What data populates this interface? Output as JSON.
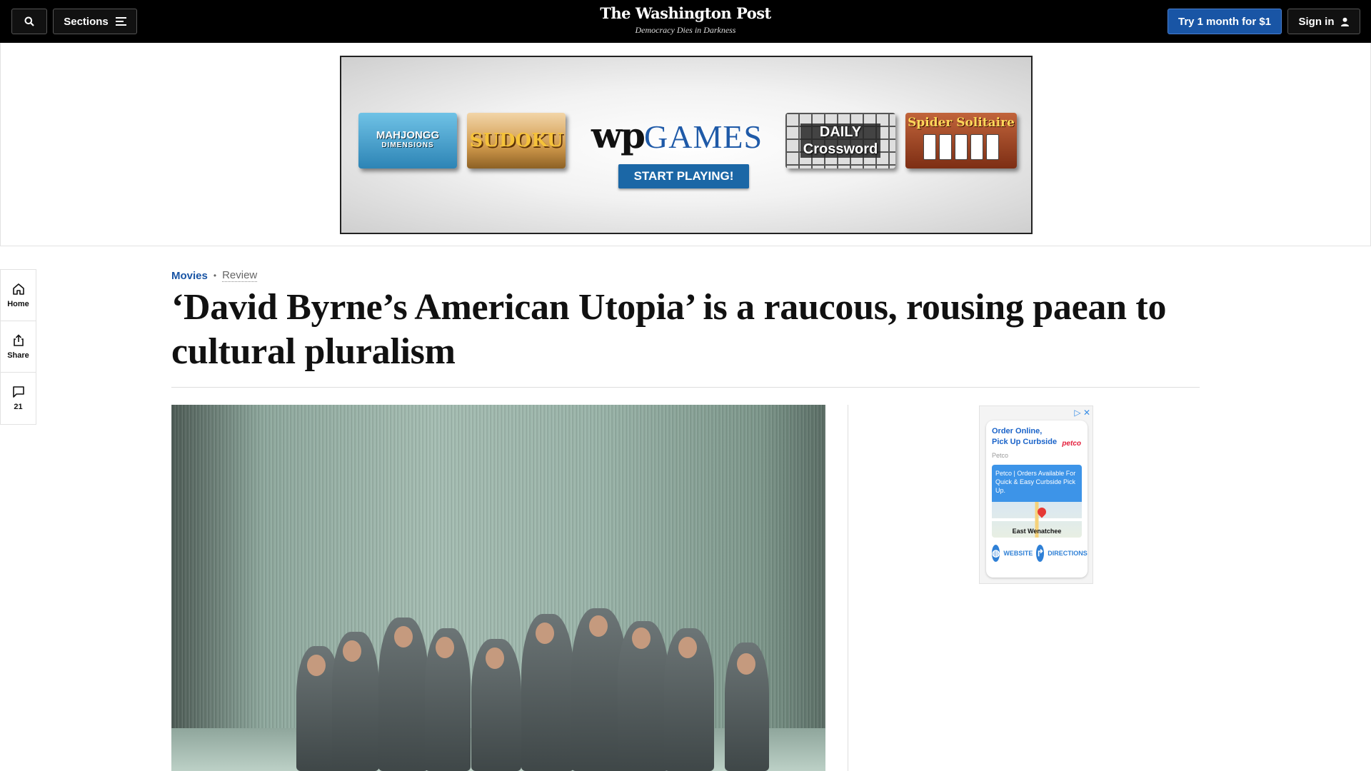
{
  "header": {
    "sections_label": "Sections",
    "logo_text": "The Washington Post",
    "tagline": "Democracy Dies in Darkness",
    "subscribe_label": "Try 1 month for $1",
    "signin_label": "Sign in"
  },
  "top_ad": {
    "tile1_line1": "MAHJONGG",
    "tile1_line2": "DIMENSIONS",
    "tile2": "SUDOKU",
    "brand_wp": "wp",
    "brand_games": "GAMES",
    "cta": "START PLAYING!",
    "tile3_line1": "DAILY",
    "tile3_line2": "Crossword",
    "tile4": "Spider Solitaire"
  },
  "rail": {
    "home_label": "Home",
    "share_label": "Share",
    "comment_count": "21"
  },
  "article": {
    "section": "Movies",
    "separator": "•",
    "label": "Review",
    "headline": "‘David Byrne’s American Utopia’ is a raucous, rousing paean to cultural pluralism"
  },
  "side_ad": {
    "adchoices": "▷ ✕",
    "title_line1": "Order Online,",
    "title_line2": "Pick Up Curbside",
    "brand": "petco",
    "advertiser": "Petco",
    "blurb": "Petco | Orders Available For Quick & Easy Curbside Pick Up.",
    "city": "East Wenatchee",
    "website_label": "WEBSITE",
    "directions_label": "DIRECTIONS"
  }
}
